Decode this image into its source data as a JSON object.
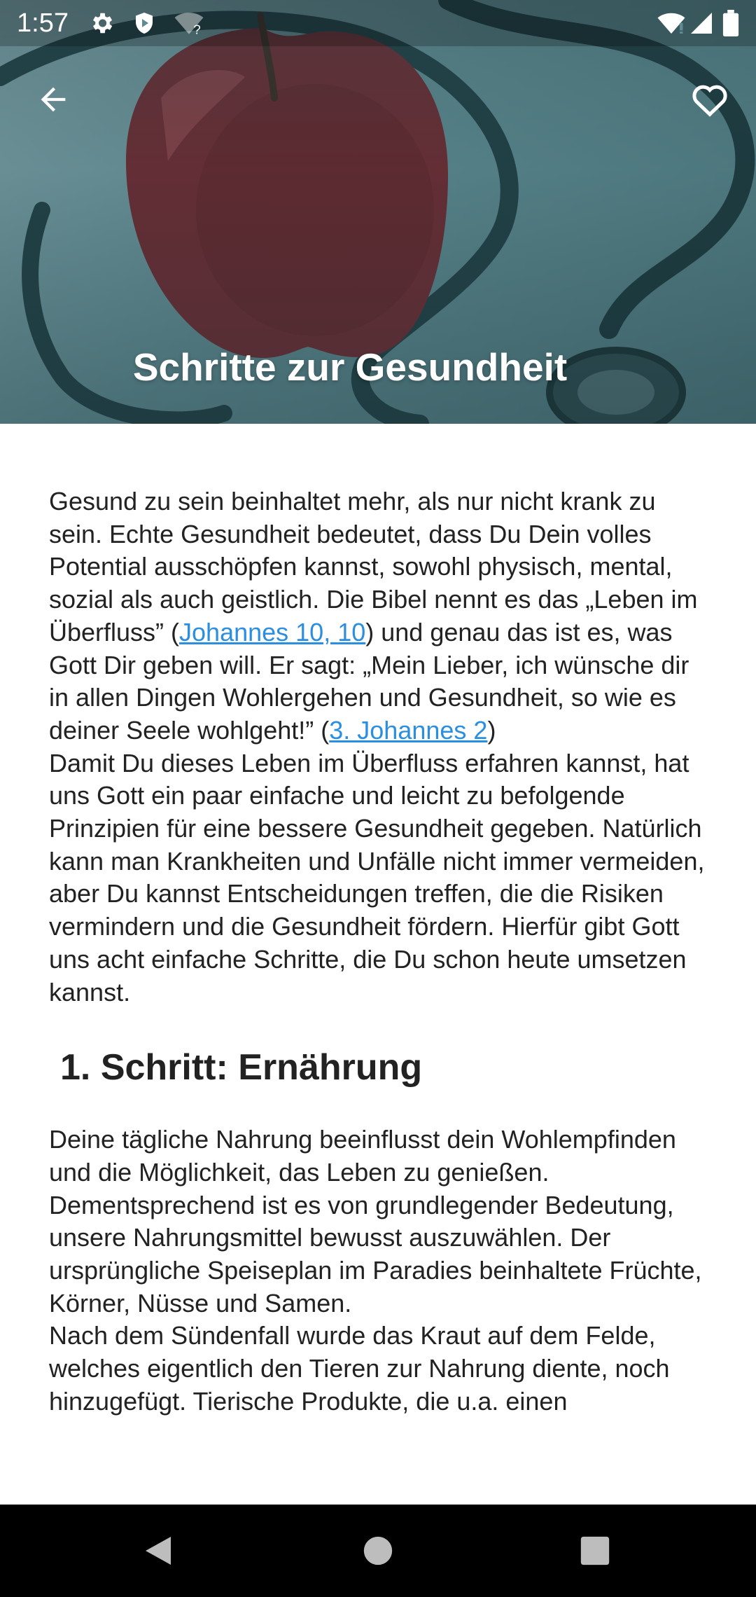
{
  "status_bar": {
    "time": "1:57",
    "icons": [
      "settings-icon",
      "shield-icon",
      "wifi-question-icon",
      "wifi-icon",
      "signal-icon",
      "battery-icon"
    ]
  },
  "toolbar": {
    "back_icon": "arrow-back-icon",
    "favorite_icon": "heart-outline-icon"
  },
  "header": {
    "title": "Schritte zur Gesundheit"
  },
  "article": {
    "intro": {
      "t1": " Gesund zu sein beinhaltet mehr, als nur nicht krank zu sein. Echte Gesundheit bedeutet, dass Du Dein volles Potential ausschöpfen kannst, sowohl physisch, mental, sozial als auch geistlich. Die Bibel nennt es das „Leben im Überfluss” (",
      "link1": "Johannes 10, 10",
      "t2": ") und genau das ist es, was Gott Dir geben will. Er sagt: „Mein Lieber, ich wünsche dir in allen Dingen Wohlergehen und Gesundheit, so wie es deiner Seele wohlgeht!” (",
      "link2": "3. Johannes 2",
      "t3": ")"
    },
    "intro_p2": "Damit Du dieses Leben im Überfluss erfahren kannst, hat uns Gott ein paar einfache und leicht zu befolgende Prinzipien für eine bessere Gesundheit gegeben. Natürlich kann man Krankheiten und Unfälle nicht immer vermeiden, aber Du kannst Entscheidungen treffen, die die Risiken vermindern und die Gesundheit fördern. Hierfür gibt Gott uns acht einfache Schritte, die Du schon heute umsetzen kannst.",
    "section1_heading": "1. Schritt: Ernährung",
    "section1_p1": " Deine tägliche Nahrung beeinflusst dein Wohlempfinden und die Möglichkeit, das Leben zu genießen. Dementsprechend ist es von grundlegender Bedeutung, unsere Nahrungsmittel bewusst auszuwählen. Der ursprüngliche Speiseplan im Paradies beinhaltete Früchte, Körner, Nüsse und Samen.",
    "section1_p2": "Nach dem Sündenfall wurde das Kraut auf dem Felde, welches eigentlich den Tieren zur Nahrung diente, noch hinzugefügt. Tierische Produkte, die u.a. einen"
  },
  "colors": {
    "link": "#2a8fe0",
    "text": "#222222",
    "header_tint": "#5f8c93",
    "navbar": "#000000"
  },
  "nav_bar": {
    "icons": [
      "back-triangle-icon",
      "home-circle-icon",
      "recents-square-icon"
    ]
  }
}
